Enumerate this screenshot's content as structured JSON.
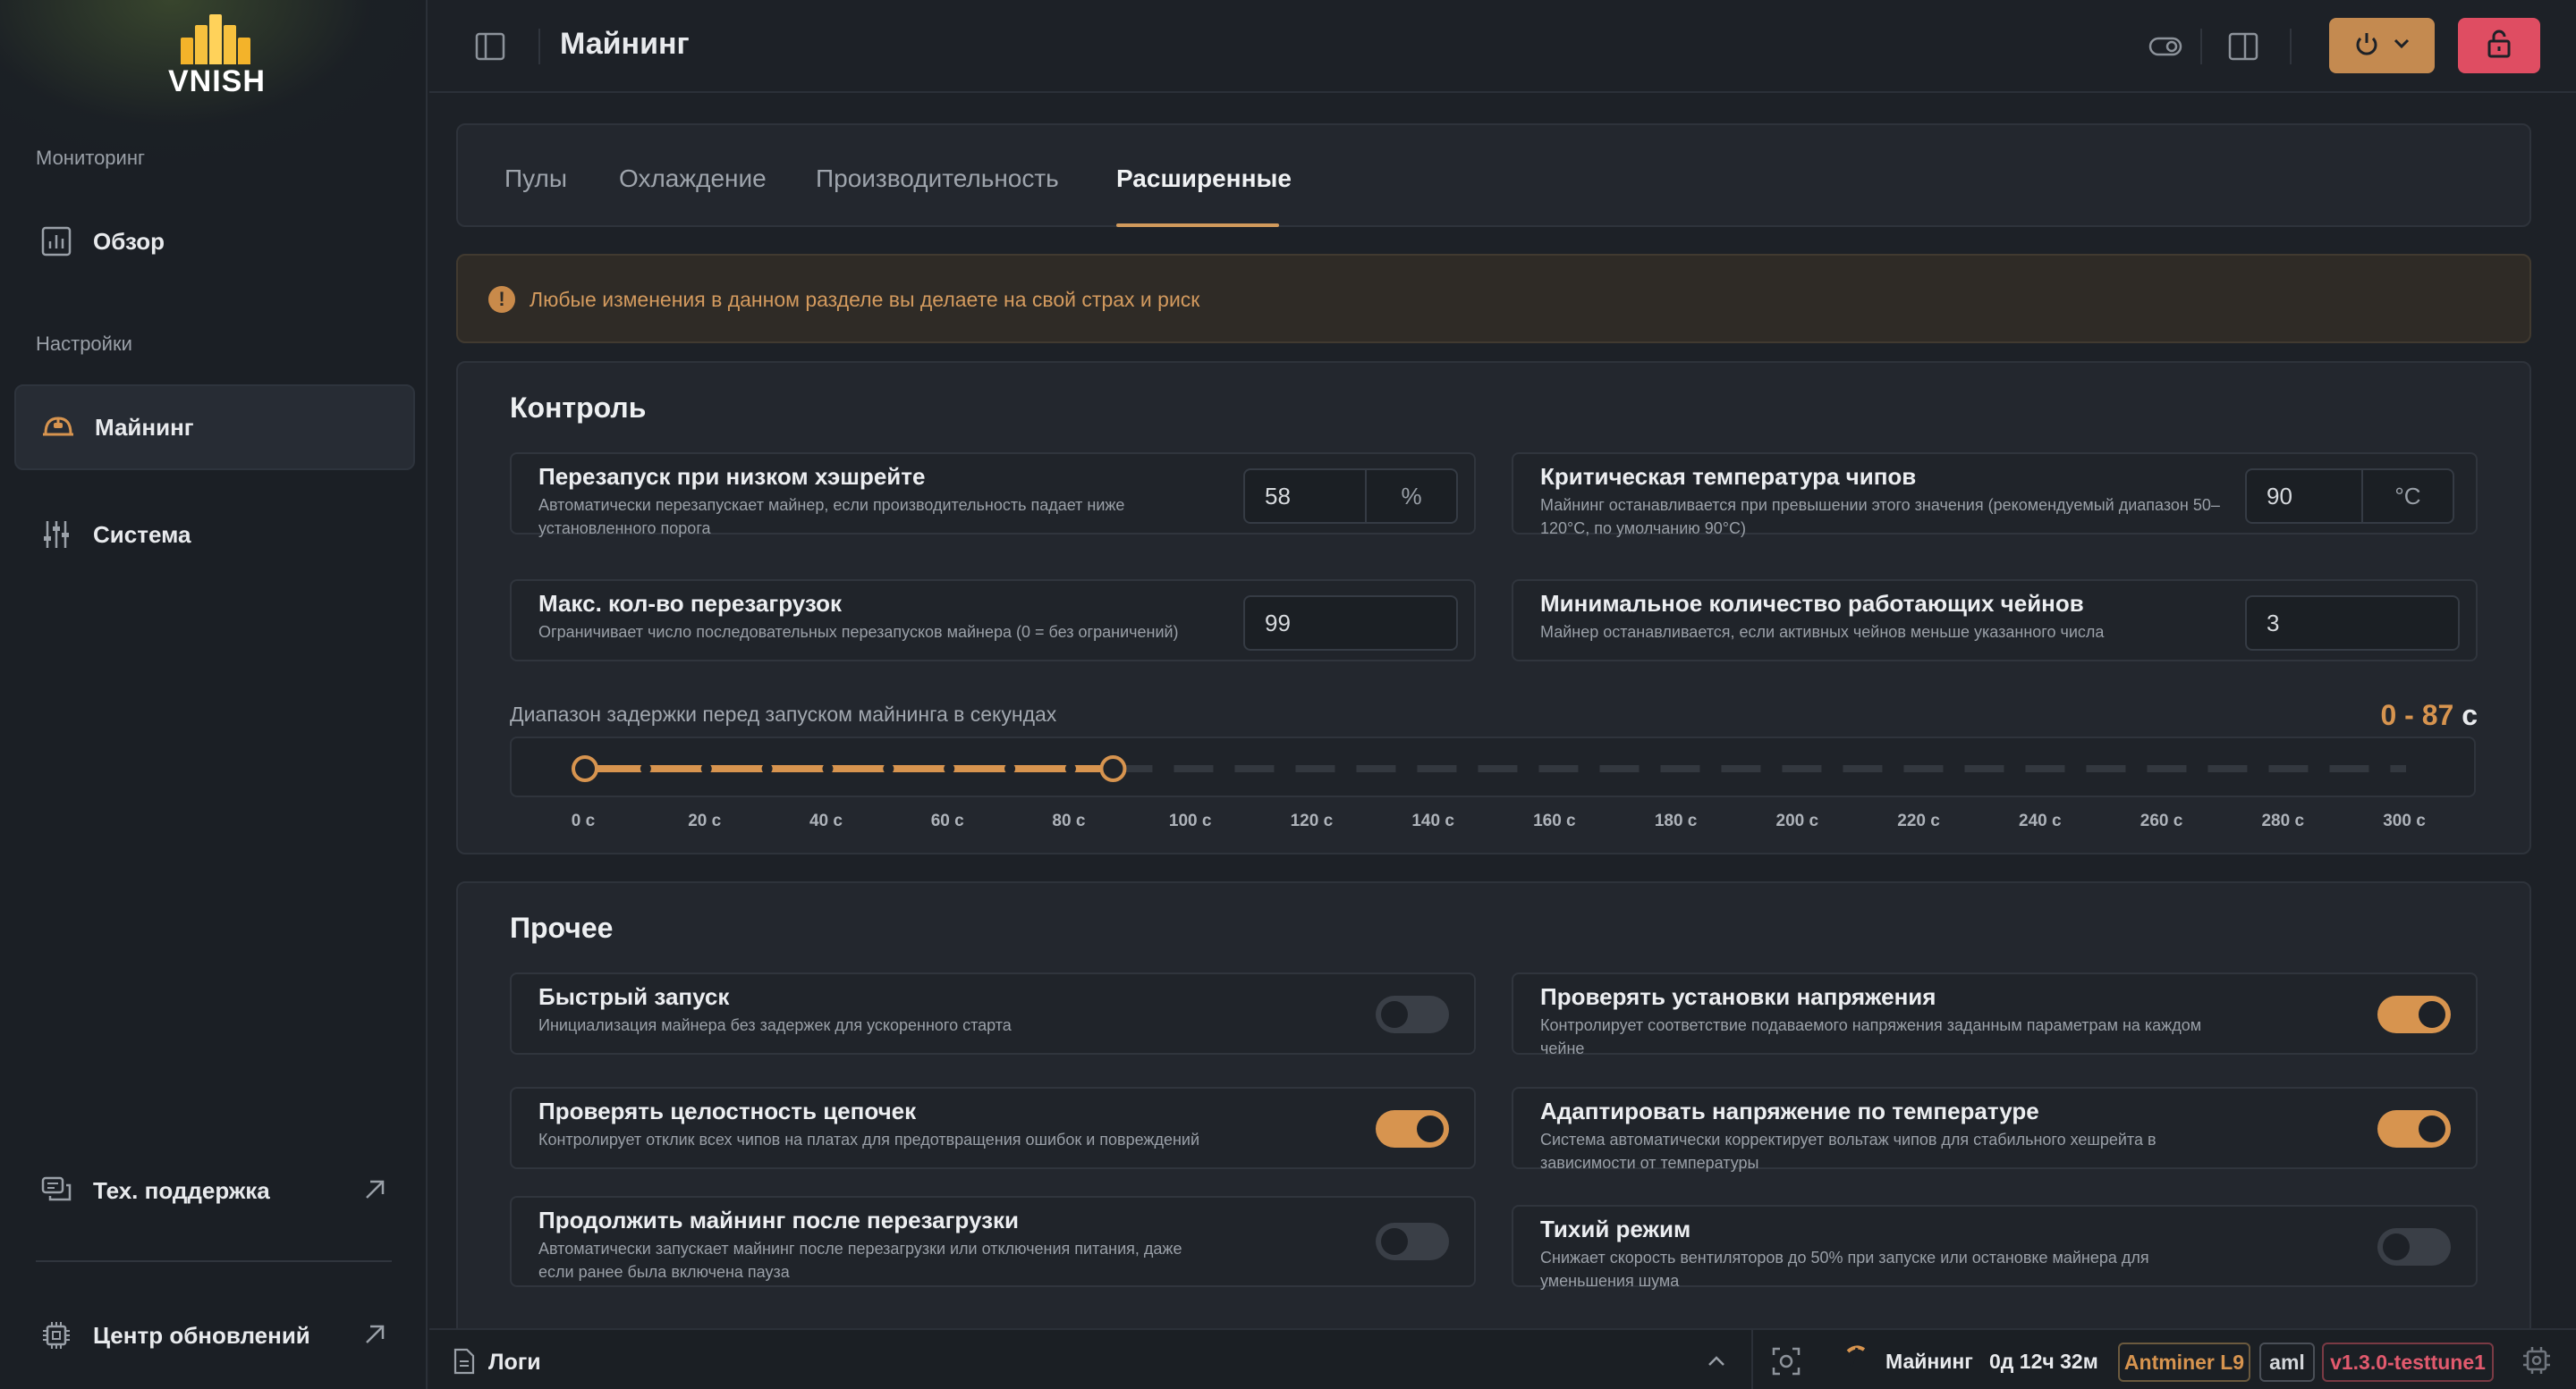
{
  "app": {
    "logo_text": "VNISH",
    "colors": {
      "accent": "#d7944f",
      "danger": "#df4d62",
      "background": "#1d2127"
    }
  },
  "sidebar": {
    "sections": [
      {
        "title": "Мониторинг",
        "items": [
          {
            "label": "Обзор",
            "icon": "chart-icon"
          }
        ]
      },
      {
        "title": "Настройки",
        "items": [
          {
            "label": "Майнинг",
            "icon": "helmet-icon",
            "active": true
          },
          {
            "label": "Система",
            "icon": "sliders-icon"
          }
        ]
      }
    ],
    "bottom": [
      {
        "label": "Тех. поддержка",
        "icon": "chat-icon",
        "external": true
      },
      {
        "label": "Центр обновлений",
        "icon": "chip-icon",
        "external": true
      }
    ]
  },
  "header": {
    "title": "Майнинг"
  },
  "tabs": [
    {
      "label": "Пулы"
    },
    {
      "label": "Охлаждение"
    },
    {
      "label": "Производительность"
    },
    {
      "label": "Расширенные",
      "active": true
    }
  ],
  "warning": {
    "text": "Любые изменения в данном разделе вы делаете на свой страх и риск"
  },
  "control": {
    "title": "Контроль",
    "settings": [
      {
        "label": "Перезапуск при низком хэшрейте",
        "desc": "Автоматически перезапускает майнер, если производительность падает ниже установленного порога",
        "value": "58",
        "unit": "%"
      },
      {
        "label": "Критическая температура чипов",
        "desc": "Майнинг останавливается при превышении этого значения (рекомендуемый диапазон 50–120°C, по умолчанию 90°C)",
        "value": "90",
        "unit": "°C"
      },
      {
        "label": "Макс. кол-во перезагрузок",
        "desc": "Ограничивает число последовательных перезапусков майнера (0 = без ограничений)",
        "value": "99"
      },
      {
        "label": "Минимальное количество работающих чейнов",
        "desc": "Майнер останавливается, если активных чейнов меньше указанного числа",
        "value": "3"
      }
    ],
    "delay_range": {
      "label": "Диапазон задержки перед запуском майнинга в секундах",
      "value_text": "0 - 87",
      "unit": "с",
      "min": 0,
      "max": 300,
      "selected_min": 0,
      "selected_max": 87,
      "step": 10,
      "tick_labels": [
        "0 с",
        "20 с",
        "40 с",
        "60 с",
        "80 с",
        "100 с",
        "120 с",
        "140 с",
        "160 с",
        "180 с",
        "200 с",
        "220 с",
        "240 с",
        "260 с",
        "280 с",
        "300 с"
      ]
    }
  },
  "other": {
    "title": "Прочее",
    "settings": [
      {
        "label": "Быстрый запуск",
        "desc": "Инициализация майнера без задержек для ускоренного старта",
        "on": false
      },
      {
        "label": "Проверять установки напряжения",
        "desc": "Контролирует соответствие подаваемого напряжения заданным параметрам на каждом чейне",
        "on": true
      },
      {
        "label": "Проверять целостность цепочек",
        "desc": "Контролирует отклик всех чипов на платах для предотвращения ошибок и повреждений",
        "on": true
      },
      {
        "label": "Адаптировать напряжение по температуре",
        "desc": "Система автоматически корректирует вольтаж чипов для стабильного хешрейта в зависимости от температуры",
        "on": true
      },
      {
        "label": "Продолжить майнинг после перезагрузки",
        "desc": "Автоматически запускает майнинг после перезагрузки или отключения питания, даже если ранее была включена пауза",
        "on": false
      },
      {
        "label": "Тихий режим",
        "desc": "Снижает скорость вентиляторов до 50% при запуске или остановке майнера для уменьшения шума",
        "on": false
      }
    ]
  },
  "footer": {
    "logs_label": "Логи",
    "status": "Майнинг",
    "uptime": "0д 12ч 32м",
    "model": "Antminer L9",
    "platform": "aml",
    "version": "v1.3.0-testtune1"
  }
}
